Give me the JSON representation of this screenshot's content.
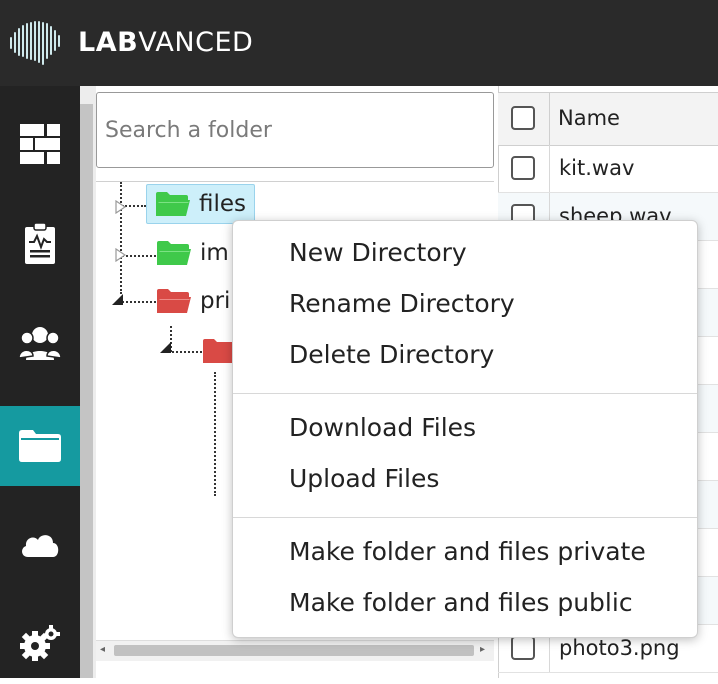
{
  "header": {
    "logo_bold": "LAB",
    "logo_regular": "VANCED",
    "logo_icon": "brain-soundwave-icon"
  },
  "sidebar": {
    "items": [
      {
        "icon": "dashboard-grid-icon",
        "active": false
      },
      {
        "icon": "clipboard-chart-icon",
        "active": false
      },
      {
        "icon": "users-group-icon",
        "active": false
      },
      {
        "icon": "folder-icon",
        "active": true
      },
      {
        "icon": "cloud-icon",
        "active": false
      },
      {
        "icon": "gears-icon",
        "active": false
      }
    ],
    "active_color": "#159aa0"
  },
  "folder_search": {
    "placeholder": "Search a folder",
    "value": ""
  },
  "folder_tree": {
    "nodes": [
      {
        "label": "files",
        "color": "green",
        "selected": true
      },
      {
        "label": "im",
        "color": "green",
        "selected": false
      },
      {
        "label": "pri",
        "color": "red",
        "selected": false
      },
      {
        "label": "",
        "color": "red",
        "selected": false
      }
    ]
  },
  "file_table": {
    "header_name": "Name",
    "rows": [
      {
        "name": "kit.wav"
      },
      {
        "name": "sheep.wav"
      },
      {
        "name": "photo3.png"
      }
    ]
  },
  "context_menu": {
    "groups": [
      [
        "New Directory",
        "Rename Directory",
        "Delete Directory"
      ],
      [
        "Download Files",
        "Upload Files"
      ],
      [
        "Make folder and files private",
        "Make folder and files public"
      ]
    ]
  },
  "colors": {
    "header_bg": "#2a2a2a",
    "sidebar_bg": "#232323",
    "folder_public": "#3fc94a",
    "folder_private": "#d94a45",
    "selection_bg": "#cdeffa"
  }
}
